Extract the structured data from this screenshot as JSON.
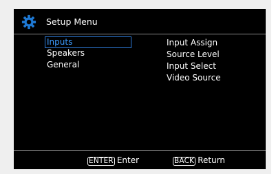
{
  "header": {
    "title": "Setup Menu",
    "icon": "gear-icon"
  },
  "menu": {
    "items": [
      {
        "label": "Inputs",
        "selected": true
      },
      {
        "label": "Speakers",
        "selected": false
      },
      {
        "label": "General",
        "selected": false
      }
    ]
  },
  "submenu": {
    "items": [
      {
        "label": "Input Assign"
      },
      {
        "label": "Source Level"
      },
      {
        "label": "Input Select"
      },
      {
        "label": "Video Source"
      }
    ]
  },
  "footer": {
    "enter_key": "ENTER",
    "enter_label": "Enter",
    "back_key": "BACK",
    "back_label": "Return"
  },
  "colors": {
    "background": "#000000",
    "text": "#ffffff",
    "selected_text": "#3c9bff",
    "selected_border": "#2f7fe0",
    "divider": "#8c8c8c",
    "icon": "#1e78d2"
  }
}
